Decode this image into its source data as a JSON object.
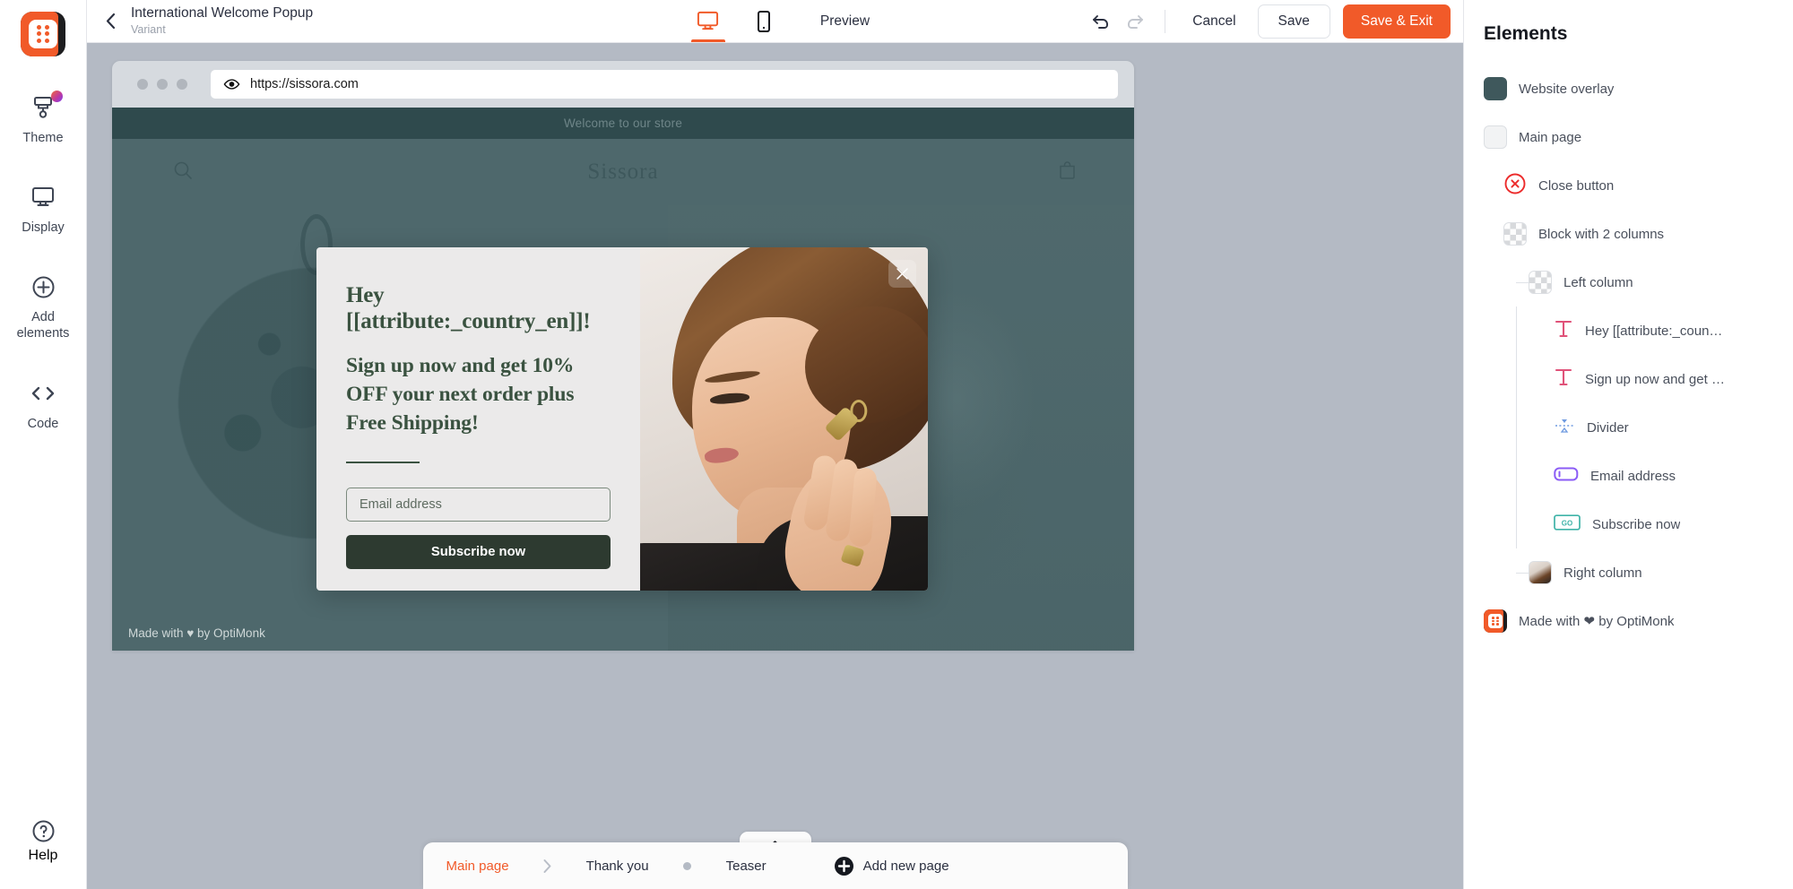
{
  "app": {
    "logo_name": "optimonk-logo-icon"
  },
  "rail": {
    "items": [
      {
        "label": "Theme",
        "icon": "paintbrush-icon",
        "badge": true
      },
      {
        "label": "Display",
        "icon": "monitor-icon",
        "badge": false
      },
      {
        "label": "Add\nelements",
        "label_line1": "Add",
        "label_line2": "elements",
        "icon": "plus-circle-icon",
        "badge": false
      },
      {
        "label": "Code",
        "icon": "code-brackets-icon",
        "badge": false
      }
    ],
    "help_label": "Help",
    "help_icon": "question-circle-icon"
  },
  "topbar": {
    "back_icon": "chevron-left-icon",
    "title": "International Welcome Popup",
    "subtitle": "Variant",
    "device_desktop": "desktop-icon",
    "device_mobile": "mobile-icon",
    "active_device": "desktop",
    "preview_label": "Preview",
    "undo_icon": "undo-icon",
    "redo_icon": "redo-icon",
    "cancel_label": "Cancel",
    "save_label": "Save",
    "save_exit_label": "Save & Exit",
    "accent_color": "#f15a29"
  },
  "browser": {
    "url": "https://sissora.com",
    "eye_icon": "eye-icon"
  },
  "site": {
    "top_banner": "Welcome to our store",
    "logo": "Sissora",
    "search_icon": "search-icon",
    "cart_icon": "shopping-bag-icon",
    "footer_note": "Made with ♥ by OptiMonk"
  },
  "popup": {
    "heading_line1": "Hey",
    "heading_line2": "[[attribute:_country_en]]!",
    "subheading": "Sign up now and get 10% OFF your next order plus Free Shipping!",
    "email_placeholder": "Email address",
    "email_value": "",
    "submit_label": "Subscribe now",
    "close_icon": "close-x-icon",
    "bg_color": "#ebeaea",
    "text_color": "#3a5240",
    "button_color": "#2d3a30"
  },
  "pagetabs": {
    "collapse_icon": "chevron-up-icon",
    "tabs": [
      {
        "label": "Main page",
        "active": true
      },
      {
        "label": "Thank you",
        "active": false
      },
      {
        "label": "Teaser",
        "active": false
      }
    ],
    "separator_icon": "chevron-right-icon",
    "dot_icon": "dot-icon",
    "add_label": "Add new page",
    "add_icon": "plus-circle-filled-icon"
  },
  "elements_panel": {
    "title": "Elements",
    "tree": [
      {
        "label": "Website overlay",
        "icon": "teal-swatch-icon",
        "swatch": "teal",
        "indent": 1
      },
      {
        "label": "Main page",
        "icon": "white-swatch-icon",
        "swatch": "white",
        "indent": 1
      },
      {
        "label": "Close button",
        "icon": "close-circle-red-icon",
        "swatch": "close",
        "indent": 2
      },
      {
        "label": "Block with 2 columns",
        "icon": "checker-swatch-icon",
        "swatch": "checker",
        "indent": 2
      },
      {
        "label": "Left column",
        "icon": "checker-swatch-icon",
        "swatch": "checker",
        "indent": 3
      },
      {
        "label": "Hey [[attribute:_coun…",
        "icon": "text-t-icon",
        "swatch": "text",
        "indent": 4
      },
      {
        "label": "Sign up now and get …",
        "icon": "text-t-icon",
        "swatch": "text",
        "indent": 4
      },
      {
        "label": "Divider",
        "icon": "divider-icon",
        "swatch": "divider",
        "indent": 4
      },
      {
        "label": "Email address",
        "icon": "input-field-icon",
        "swatch": "input",
        "indent": 4
      },
      {
        "label": "Subscribe now",
        "icon": "go-button-icon",
        "swatch": "go",
        "indent": 4
      },
      {
        "label": "Right column",
        "icon": "image-thumbnail-icon",
        "swatch": "photo",
        "indent": 3
      },
      {
        "label": "Made with ❤ by OptiMonk",
        "icon": "optimonk-logo-icon",
        "swatch": "om",
        "indent": 1
      }
    ]
  }
}
